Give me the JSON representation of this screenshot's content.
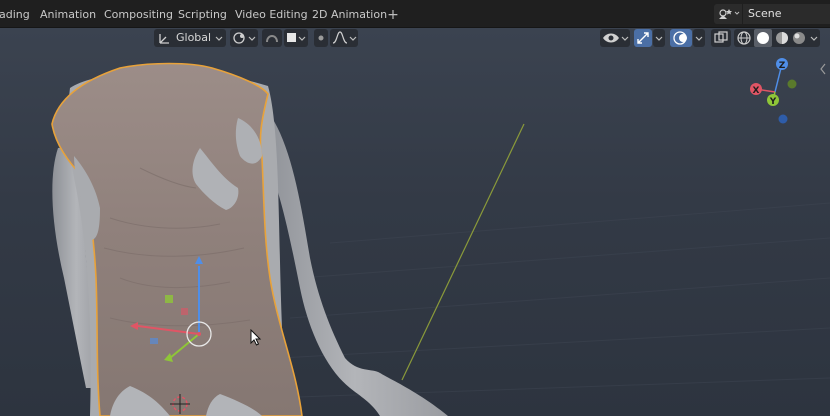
{
  "workspace_tabs": [
    {
      "label": "ading"
    },
    {
      "label": "Animation"
    },
    {
      "label": "Compositing"
    },
    {
      "label": "Scripting"
    },
    {
      "label": "Video Editing"
    },
    {
      "label": "2D Animation"
    }
  ],
  "add_tab_symbol": "+",
  "scene": {
    "name": "Scene",
    "icon": "scene-icon"
  },
  "viewport_header": {
    "transform_orientation": "Global",
    "pivot_icon": "pivot-point-icon",
    "snap_icon": "snap-icon",
    "proportional_icon": "proportional-edit-icon",
    "falloff_icon": "falloff-curve-icon",
    "overlay_icon": "overlay-icon",
    "gizmo_icon": "gizmo-icon",
    "xray_icon": "xray-icon",
    "shading_modes": [
      "wireframe",
      "solid",
      "material-preview",
      "rendered"
    ],
    "active_shading": "solid"
  },
  "navigation_gizmo": {
    "axes": [
      "X",
      "Y",
      "Z"
    ]
  },
  "colors": {
    "accent": "#4b6fa6",
    "selection_outline": "#e8a23a",
    "axis_x": "#e05565",
    "axis_y": "#8fc638",
    "axis_z": "#4f8ee8"
  }
}
